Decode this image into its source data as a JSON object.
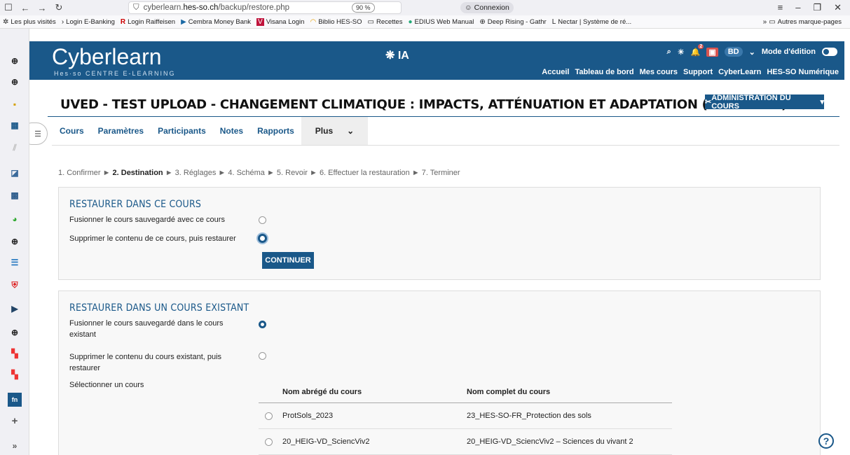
{
  "browser": {
    "url_prefix": "cyberlearn.",
    "url_host": "hes-so.ch",
    "url_path": "/backup/restore.php",
    "zoom": "90 %",
    "connexion": "Connexion",
    "bookmarks": [
      "Les plus visités",
      "Login E-Banking",
      "Login Raiffeisen",
      "Cembra Money Bank",
      "Visana Login",
      "Biblio HES-SO",
      "Recettes",
      "EDIUS Web Manual",
      "Deep Rising - Gathr",
      "Nectar | Système de ré..."
    ],
    "other_bookmarks": "Autres marque-pages"
  },
  "header": {
    "logo": "Cyberlearn",
    "logo_sub": "Hes·so CENTRE E-LEARNING",
    "ia": "IA",
    "user_initials": "BD",
    "edit_mode": "Mode d'édition",
    "notif_count": "2",
    "links": [
      "Accueil",
      "Tableau de bord",
      "Mes cours",
      "Support",
      "CyberLearn",
      "HES-SO Numérique"
    ]
  },
  "page": {
    "title": "UVED - TEST UPLOAD - CHANGEMENT CLIMATIQUE : IMPACTS, ATTÉNUATION ET ADAPTATION (DÉBUTANT)",
    "admin_button": "ADMINISTRATION DU COURS"
  },
  "subnav": [
    "Cours",
    "Paramètres",
    "Participants",
    "Notes",
    "Rapports"
  ],
  "subnav_more": "Plus",
  "steps": {
    "s1": "1. Confirmer ► ",
    "s2": "2. Destination",
    "rest": " ► 3. Réglages ► 4. Schéma ► 5. Revoir ► 6. Effectuer la restauration ► 7. Terminer"
  },
  "panel1": {
    "title": "RESTAURER DANS CE COURS",
    "opt_merge": "Fusionner le cours sauvegardé avec ce cours",
    "opt_delete": "Supprimer le contenu de ce cours, puis restaurer",
    "continue": "CONTINUER"
  },
  "panel2": {
    "title": "RESTAURER DANS UN COURS EXISTANT",
    "opt_merge": "Fusionner le cours sauvegardé dans le cours existant",
    "opt_delete": "Supprimer le contenu du cours existant, puis restaurer",
    "select_label": "Sélectionner un cours",
    "col_short": "Nom abrégé du cours",
    "col_full": "Nom complet du cours",
    "rows": [
      {
        "short": "ProtSols_2023",
        "full": "23_HES-SO-FR_Protection des sols"
      },
      {
        "short": "20_HEIG-VD_SciencViv2",
        "full": "20_HEIG-VD_SciencViv2 – Sciences du vivant 2"
      }
    ]
  },
  "help": "?"
}
